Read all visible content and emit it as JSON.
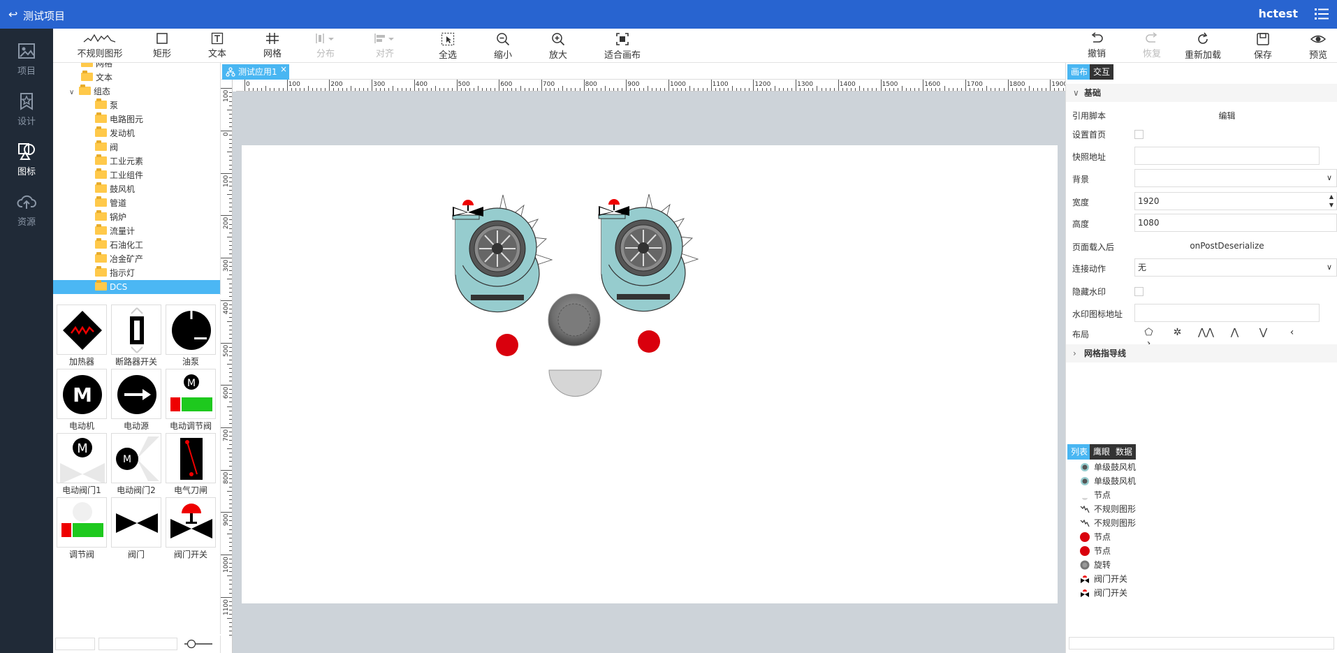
{
  "header": {
    "title": "测试项目",
    "user": "hctest"
  },
  "nav": [
    {
      "label": "项目",
      "icon": "image-icon"
    },
    {
      "label": "设计",
      "icon": "star-icon"
    },
    {
      "label": "图标",
      "icon": "shapes-icon"
    },
    {
      "label": "资源",
      "icon": "upload-cloud-icon"
    }
  ],
  "toolbar": {
    "irregular": "不规则图形",
    "rect": "矩形",
    "text": "文本",
    "grid": "网格",
    "distribute": "分布",
    "align": "对齐",
    "select_all": "全选",
    "zoom_out": "缩小",
    "zoom_in": "放大",
    "fit": "适合画布",
    "undo": "撤销",
    "redo": "恢复",
    "reload": "重新加载",
    "save": "保存",
    "preview": "预览"
  },
  "tree": [
    {
      "label": "网格",
      "level": 2
    },
    {
      "label": "文本",
      "level": 2
    },
    {
      "label": "组态",
      "level": 2,
      "expanded": true
    },
    {
      "label": "泵",
      "level": 3
    },
    {
      "label": "电路图元",
      "level": 3
    },
    {
      "label": "发动机",
      "level": 3
    },
    {
      "label": "阀",
      "level": 3
    },
    {
      "label": "工业元素",
      "level": 3
    },
    {
      "label": "工业组件",
      "level": 3
    },
    {
      "label": "鼓风机",
      "level": 3
    },
    {
      "label": "管道",
      "level": 3
    },
    {
      "label": "锅炉",
      "level": 3
    },
    {
      "label": "流量计",
      "level": 3
    },
    {
      "label": "石油化工",
      "level": 3
    },
    {
      "label": "冶金矿产",
      "level": 3
    },
    {
      "label": "指示灯",
      "level": 3
    },
    {
      "label": "DCS",
      "level": 3,
      "selected": true
    }
  ],
  "gallery": [
    "加热器",
    "断路器开关",
    "油泵",
    "电动机",
    "电动源",
    "电动调节阀",
    "电动阀门1",
    "电动阀门2",
    "电气刀闸",
    "调节阀",
    "阀门",
    "阀门开关"
  ],
  "tab": {
    "label": "测试应用1",
    "close": "×"
  },
  "ruler": {
    "h": [
      "0",
      "100",
      "200",
      "300",
      "400",
      "500",
      "600",
      "700",
      "800",
      "900",
      "1000",
      "1100",
      "1200",
      "1300",
      "1400",
      "1500",
      "1600",
      "1700",
      "1800",
      "1900"
    ],
    "v": [
      "100",
      "0",
      "100",
      "200",
      "300",
      "400",
      "500",
      "600",
      "700",
      "800",
      "900",
      "1000",
      "1100"
    ]
  },
  "right": {
    "tabs": [
      "画布",
      "交互"
    ],
    "section_basic": "基础",
    "props": {
      "script_label": "引用脚本",
      "script_value": "编辑",
      "home_label": "设置首页",
      "snapshot_label": "快照地址",
      "bg_label": "背景",
      "width_label": "宽度",
      "width_value": "1920",
      "height_label": "高度",
      "height_value": "1080",
      "onload_label": "页面载入后",
      "onload_value": "onPostDeserialize",
      "action_label": "连接动作",
      "action_value": "无",
      "watermark_label": "隐藏水印",
      "wm_icon_label": "水印图标地址",
      "layout_label": "布局"
    },
    "section_grid": "网格指导线",
    "list_tabs": [
      "列表",
      "鹰眼",
      "数据"
    ],
    "list": [
      {
        "label": "单级鼓风机",
        "icon": "blower-icon"
      },
      {
        "label": "单级鼓风机",
        "icon": "blower-icon"
      },
      {
        "label": "节点",
        "icon": "node-icon"
      },
      {
        "label": "不规则图形",
        "icon": "zigzag-icon"
      },
      {
        "label": "不规则图形",
        "icon": "zigzag-icon"
      },
      {
        "label": "节点",
        "icon": "red-dot-icon"
      },
      {
        "label": "节点",
        "icon": "red-dot-icon"
      },
      {
        "label": "旋转",
        "icon": "gray-dot-icon"
      },
      {
        "label": "阀门开关",
        "icon": "valve-icon"
      },
      {
        "label": "阀门开关",
        "icon": "valve-icon"
      }
    ]
  },
  "colors": {
    "primary": "#2864d0",
    "accent": "#49b6f2",
    "nav_bg": "#202a37",
    "canvas_bg": "#cdd3d9",
    "red": "#d9000d"
  }
}
